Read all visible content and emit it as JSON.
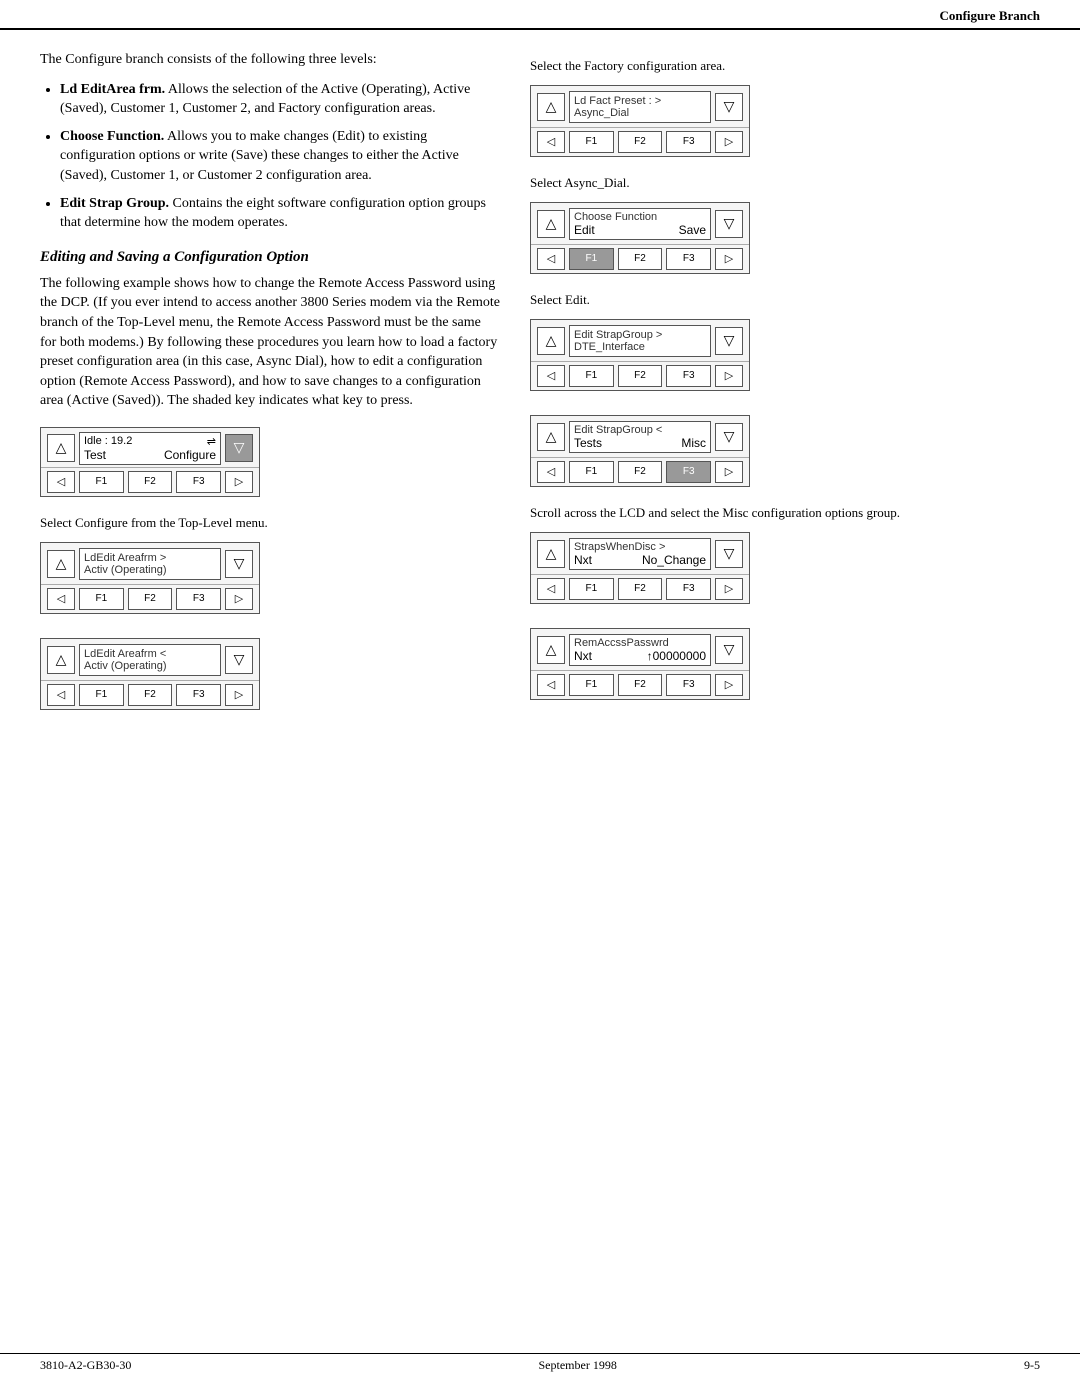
{
  "header": {
    "title": "Configure Branch"
  },
  "footer": {
    "part_number": "3810-A2-GB30-30",
    "date": "September 1998",
    "page": "9-5"
  },
  "intro": {
    "p1": "The Configure branch consists of the following three levels:",
    "bullets": [
      {
        "term": "Ld EditArea frm.",
        "text": "Allows the selection of the Active (Operating), Active (Saved), Customer 1, Customer 2, and Factory configuration areas."
      },
      {
        "term": "Choose Function.",
        "text": "Allows you to make changes (Edit) to existing configuration options or write (Save) these changes to either the Active (Saved), Customer 1, or Customer 2 configuration area."
      },
      {
        "term": "Edit Strap Group.",
        "text": "Contains the eight software configuration option groups that determine how the modem operates."
      }
    ]
  },
  "section_heading": "Editing and Saving a Configuration Option",
  "section_body": "The following example shows how to change the Remote Access Password using the DCP. (If you ever intend to access another 3800 Series modem via the Remote branch of the Top-Level menu, the Remote Access Password must be the same for both modems.) By following these procedures you learn how to load a factory preset configuration area (in this case, Async Dial), how to edit a configuration option (Remote Access Password), and how to save changes to a configuration area (Active (Saved)). The shaded key indicates what key to press.",
  "panels": {
    "idle": {
      "line1_left": "Idle : 19.2",
      "line1_right": "⇌",
      "line2_left": "Test",
      "line2_right": "Configure",
      "f1": "F1",
      "f2": "F2",
      "f3": "F3",
      "shaded": "right"
    },
    "caption_configure": "Select Configure from the Top-Level menu.",
    "ldedit_active1": {
      "line1": "LdEdit Areafrm    >",
      "line2": "Activ (Operating)",
      "f1": "F1",
      "f2": "F2",
      "f3": "F3"
    },
    "ldedit_active2": {
      "line1": "LdEdit Areafrm    <",
      "line2": "Activ (Operating)",
      "f1": "F1",
      "f2": "F2",
      "f3": "F3"
    },
    "ldfact": {
      "line1": "Ld Fact Preset :   >",
      "line2": "Async_Dial",
      "caption": "Select the Factory configuration area.",
      "f1": "F1",
      "f2": "F2",
      "f3": "F3"
    },
    "caption_asyncdial": "Select Async_Dial.",
    "choose_function": {
      "line1": "Choose Function",
      "line2_left": "Edit",
      "line2_right": "Save",
      "f1": "F1",
      "f2": "F2",
      "f3": "F3"
    },
    "caption_edit": "Select Edit.",
    "edit_strap1": {
      "line1": "Edit StrapGroup   >",
      "line2": "DTE_Interface",
      "f1": "F1",
      "f2": "F2",
      "f3": "F3"
    },
    "edit_strap2": {
      "line1": "Edit StrapGroup   <",
      "line2_left": "Tests",
      "line2_right": "Misc",
      "f1": "F1",
      "f2": "F2",
      "f3": "F3"
    },
    "caption_misc": "Scroll across the LCD and select the Misc configuration options group.",
    "straps_when": {
      "line1": "StrapsWhenDisc   >",
      "line2_left": "Nxt",
      "line2_right": "No_Change",
      "f1": "F1",
      "f2": "F2",
      "f3": "F3"
    },
    "rem_access": {
      "line1": "RemAccssPasswrd",
      "line2_left": "Nxt",
      "line2_right": "↑00000000",
      "f1": "F1",
      "f2": "F2",
      "f3": "F3"
    }
  }
}
